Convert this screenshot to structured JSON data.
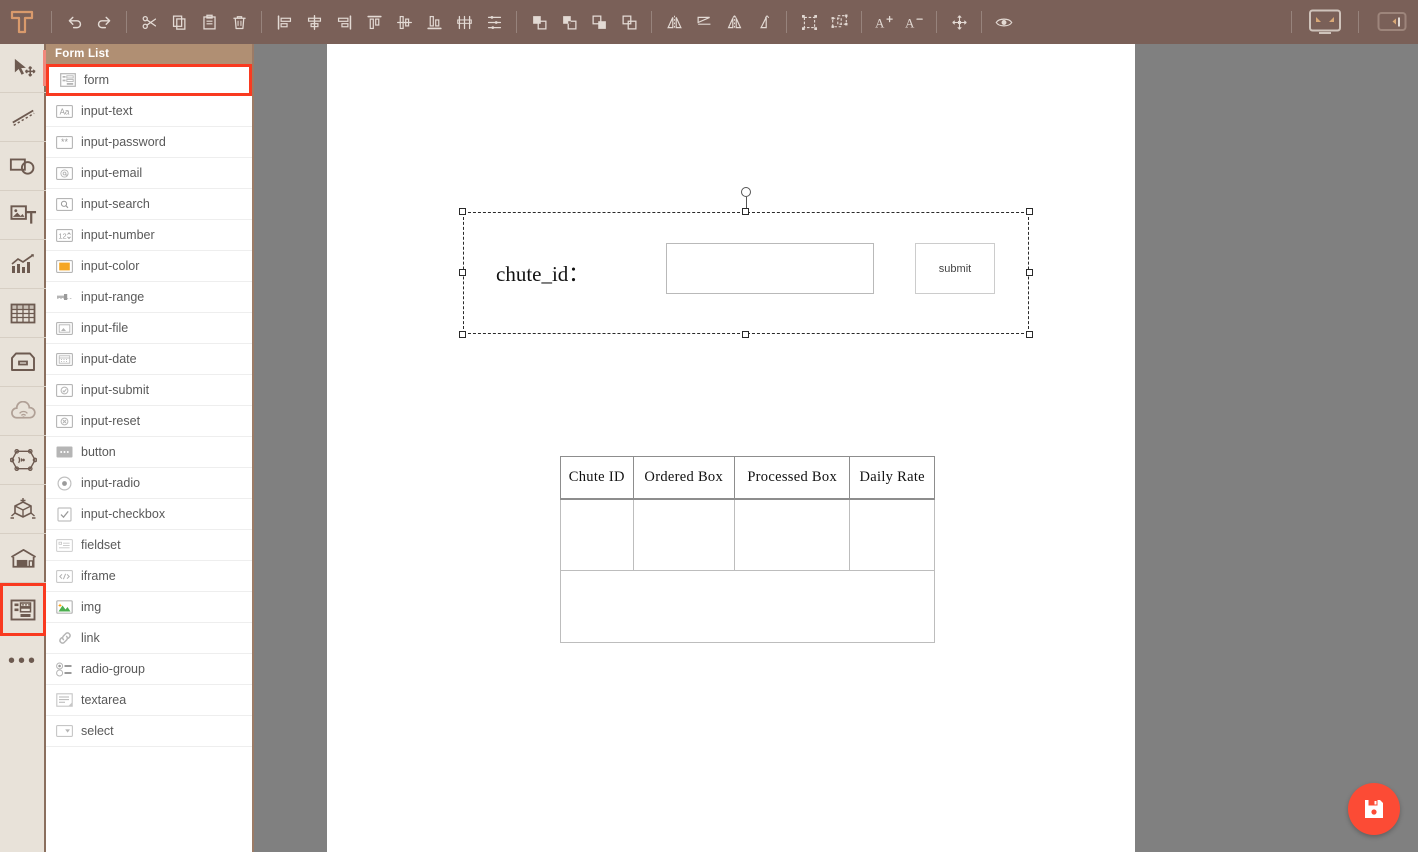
{
  "app": {
    "logo": "T-logo",
    "accent_brown": "#7a6058",
    "accent_red": "#f93a20",
    "fab_color": "#fc4b35",
    "canvas_bg": "#808080"
  },
  "toolbar": {
    "groups": [
      {
        "name": "history",
        "buttons": [
          {
            "label": "Undo",
            "icon": "undo-icon"
          },
          {
            "label": "Redo",
            "icon": "redo-icon"
          }
        ]
      },
      {
        "name": "clipboard",
        "buttons": [
          {
            "label": "Cut",
            "icon": "scissors-icon"
          },
          {
            "label": "Copy",
            "icon": "copy-icon"
          },
          {
            "label": "Paste",
            "icon": "paste-icon"
          },
          {
            "label": "Delete",
            "icon": "trash-icon"
          }
        ]
      },
      {
        "name": "align",
        "buttons": [
          {
            "label": "Align left",
            "icon": "align-left-icon"
          },
          {
            "label": "Align center horizontal",
            "icon": "align-center-h-icon"
          },
          {
            "label": "Align right",
            "icon": "align-right-icon"
          },
          {
            "label": "Align top",
            "icon": "align-top-icon"
          },
          {
            "label": "Align middle vertical",
            "icon": "align-middle-v-icon"
          },
          {
            "label": "Align bottom",
            "icon": "align-bottom-icon"
          },
          {
            "label": "Distribute horizontally",
            "icon": "distribute-h-icon"
          },
          {
            "label": "Distribute vertically",
            "icon": "distribute-v-icon"
          }
        ]
      },
      {
        "name": "order",
        "buttons": [
          {
            "label": "Bring to front",
            "icon": "bring-to-front-icon"
          },
          {
            "label": "Bring forward",
            "icon": "bring-forward-icon"
          },
          {
            "label": "Send backward",
            "icon": "send-backward-icon"
          },
          {
            "label": "Send to back",
            "icon": "send-to-back-icon"
          }
        ]
      },
      {
        "name": "flip",
        "buttons": [
          {
            "label": "Flip horizontal",
            "icon": "flip-horizontal-icon"
          },
          {
            "label": "Flip vertical",
            "icon": "flip-vertical-icon"
          },
          {
            "label": "Mirror horizontal",
            "icon": "mirror-horizontal-icon"
          },
          {
            "label": "Mirror vertical",
            "icon": "mirror-vertical-icon"
          }
        ]
      },
      {
        "name": "group",
        "buttons": [
          {
            "label": "Group",
            "icon": "group-icon"
          },
          {
            "label": "Ungroup",
            "icon": "ungroup-icon"
          }
        ]
      },
      {
        "name": "font",
        "buttons": [
          {
            "label": "Increase font size",
            "icon": "font-increase-icon"
          },
          {
            "label": "Decrease font size",
            "icon": "font-decrease-icon"
          }
        ]
      },
      {
        "name": "transform",
        "buttons": [
          {
            "label": "Move / resize",
            "icon": "move-resize-icon"
          }
        ]
      },
      {
        "name": "view",
        "buttons": [
          {
            "label": "Preview",
            "icon": "eye-icon"
          }
        ]
      }
    ],
    "right_buttons": [
      {
        "label": "Fullscreen preview",
        "icon": "monitor-icon"
      },
      {
        "label": "Toggle right panel",
        "icon": "panel-toggle-icon"
      }
    ]
  },
  "rail": {
    "items": [
      {
        "label": "Select / Move",
        "icon": "cursor-move-icon",
        "selected": false,
        "active_strip": true
      },
      {
        "label": "Line / Path",
        "icon": "dashed-line-icon",
        "selected": false,
        "active_strip": false
      },
      {
        "label": "Shapes",
        "icon": "shapes-icon",
        "selected": false,
        "active_strip": false
      },
      {
        "label": "Image and Text",
        "icon": "image-text-icon",
        "selected": false,
        "active_strip": false
      },
      {
        "label": "Charts",
        "icon": "chart-icon",
        "selected": false,
        "active_strip": false
      },
      {
        "label": "Table",
        "icon": "table-icon",
        "selected": false,
        "active_strip": false
      },
      {
        "label": "Container",
        "icon": "drawer-icon",
        "selected": false,
        "active_strip": false
      },
      {
        "label": "Cloud",
        "icon": "cloud-wifi-icon",
        "selected": false,
        "active_strip": false
      },
      {
        "label": "Network",
        "icon": "network-sensor-icon",
        "selected": false,
        "active_strip": false
      },
      {
        "label": "3D Model",
        "icon": "cube-3d-icon",
        "selected": false,
        "active_strip": false
      },
      {
        "label": "Warehouse",
        "icon": "warehouse-icon",
        "selected": false,
        "active_strip": false
      },
      {
        "label": "Form",
        "icon": "form-panel-icon",
        "selected": true,
        "active_strip": false
      },
      {
        "label": "More",
        "icon": "more-dots-icon",
        "selected": false,
        "active_strip": false
      }
    ],
    "more_glyph": "•••"
  },
  "panel": {
    "header": "Form List",
    "items": [
      {
        "label": "form",
        "icon": "form-icon",
        "selected": true
      },
      {
        "label": "input-text",
        "icon": "input-text-icon",
        "selected": false
      },
      {
        "label": "input-password",
        "icon": "input-password-icon",
        "selected": false
      },
      {
        "label": "input-email",
        "icon": "input-email-icon",
        "selected": false
      },
      {
        "label": "input-search",
        "icon": "input-search-icon",
        "selected": false
      },
      {
        "label": "input-number",
        "icon": "input-number-icon",
        "selected": false
      },
      {
        "label": "input-color",
        "icon": "input-color-icon",
        "selected": false
      },
      {
        "label": "input-range",
        "icon": "input-range-icon",
        "selected": false
      },
      {
        "label": "input-file",
        "icon": "input-file-icon",
        "selected": false
      },
      {
        "label": "input-date",
        "icon": "input-date-icon",
        "selected": false
      },
      {
        "label": "input-submit",
        "icon": "input-submit-icon",
        "selected": false
      },
      {
        "label": "input-reset",
        "icon": "input-reset-icon",
        "selected": false
      },
      {
        "label": "button",
        "icon": "button-icon",
        "selected": false
      },
      {
        "label": "input-radio",
        "icon": "input-radio-icon",
        "selected": false
      },
      {
        "label": "input-checkbox",
        "icon": "input-checkbox-icon",
        "selected": false
      },
      {
        "label": "fieldset",
        "icon": "fieldset-icon",
        "selected": false
      },
      {
        "label": "iframe",
        "icon": "iframe-icon",
        "selected": false
      },
      {
        "label": "img",
        "icon": "img-icon",
        "selected": false
      },
      {
        "label": "link",
        "icon": "link-icon",
        "selected": false
      },
      {
        "label": "radio-group",
        "icon": "radio-group-icon",
        "selected": false
      },
      {
        "label": "textarea",
        "icon": "textarea-icon",
        "selected": false
      },
      {
        "label": "select",
        "icon": "select-icon",
        "selected": false
      }
    ]
  },
  "canvas": {
    "form": {
      "label": "chute_id：",
      "input_value": "",
      "input_placeholder": "",
      "submit_label": "submit",
      "selected": true
    },
    "table": {
      "headers": [
        "Chute ID",
        "Ordered Box",
        "Processed Box",
        "Daily Rate"
      ],
      "body_rows": [
        [
          "",
          "",
          "",
          ""
        ]
      ],
      "footer_row": [
        ""
      ]
    }
  },
  "fab": {
    "label": "Save",
    "icon": "save-icon"
  }
}
